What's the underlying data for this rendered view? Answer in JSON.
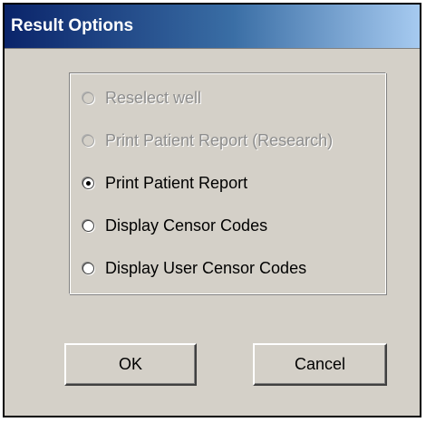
{
  "window": {
    "title": "Result Options"
  },
  "options": [
    {
      "label": "Reselect well",
      "enabled": false,
      "selected": false
    },
    {
      "label": "Print Patient Report (Research)",
      "enabled": false,
      "selected": false
    },
    {
      "label": "Print Patient Report",
      "enabled": true,
      "selected": true
    },
    {
      "label": "Display Censor Codes",
      "enabled": true,
      "selected": false
    },
    {
      "label": "Display User Censor Codes",
      "enabled": true,
      "selected": false
    }
  ],
  "buttons": {
    "ok_label": "OK",
    "cancel_label": "Cancel"
  },
  "colors": {
    "title_gradient_start": "#0a246a",
    "title_gradient_end": "#a6caf0",
    "dialog_face": "#d4d0c8",
    "disabled_text": "#8d8d8d"
  }
}
